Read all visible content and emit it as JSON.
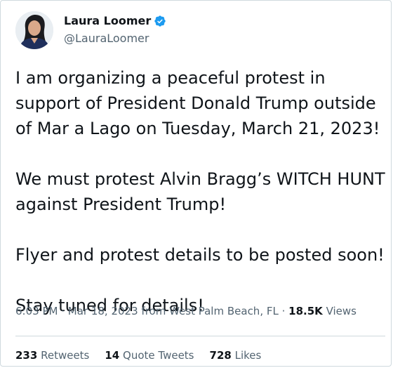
{
  "author": {
    "name": "Laura Loomer",
    "handle": "@LauraLoomer",
    "verified_icon": "verified-badge-icon",
    "accent_color": "#1d9bf0"
  },
  "tweet": {
    "paragraphs": [
      "I am organizing a peaceful protest in support of President Donald Trump outside of Mar a Lago on Tuesday, March 21, 2023!",
      "We must protest Alvin Bragg’s WITCH HUNT against President Trump!",
      "Flyer and protest details to be posted soon!",
      "Stay tuned for details!"
    ]
  },
  "meta": {
    "time": "6:03 PM",
    "separator": " · ",
    "date": "Mar 18, 2023",
    "location": "from West Palm Beach, FL",
    "views_count": "18.5K",
    "views_label": "Views"
  },
  "stats": {
    "retweets_count": "233",
    "retweets_label": "Retweets",
    "quotes_count": "14",
    "quotes_label": "Quote Tweets",
    "likes_count": "728",
    "likes_label": "Likes"
  }
}
